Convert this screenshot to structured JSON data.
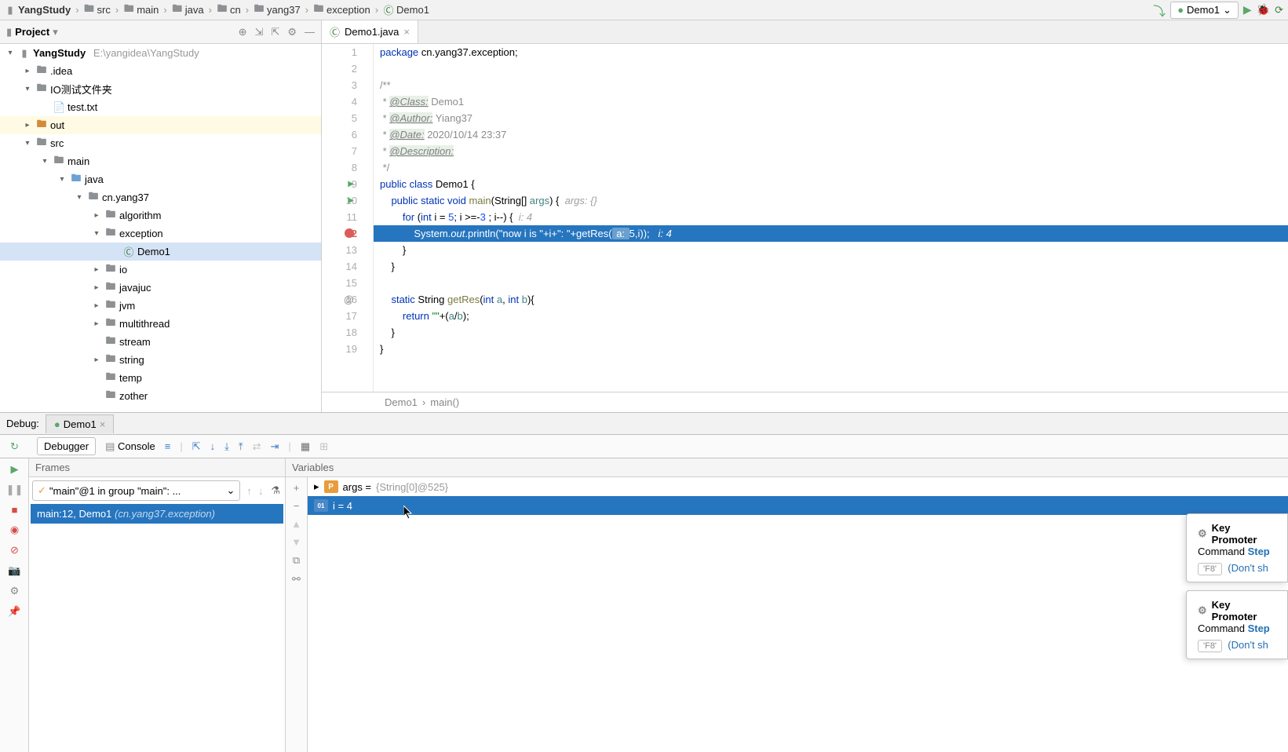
{
  "breadcrumbs": [
    "YangStudy",
    "src",
    "main",
    "java",
    "cn",
    "yang37",
    "exception",
    "Demo1"
  ],
  "run_config": "Demo1",
  "project": {
    "title": "Project",
    "root": "YangStudy",
    "root_path": "E:\\yangidea\\YangStudy",
    "nodes": {
      "idea": ".idea",
      "io_folder": "IO测试文件夹",
      "test_txt": "test.txt",
      "out": "out",
      "src": "src",
      "main": "main",
      "java": "java",
      "cn_yang37": "cn.yang37",
      "algorithm": "algorithm",
      "exception": "exception",
      "demo1": "Demo1",
      "io": "io",
      "javajuc": "javajuc",
      "jvm": "jvm",
      "multithread": "multithread",
      "stream": "stream",
      "string": "string",
      "temp": "temp",
      "zother": "zother"
    }
  },
  "tab": "Demo1.java",
  "code": {
    "l1": "package cn.yang37.exception;",
    "l3": "/**",
    "l4_tag": "@Class:",
    "l4_val": " Demo1",
    "l5_tag": "@Author:",
    "l5_val": " Yiang37",
    "l6_tag": "@Date:",
    "l6_val": " 2020/10/14 23:37",
    "l7_tag": "@Description:",
    "l8": " */",
    "l9": "public class Demo1 {",
    "l10_a": "    public static void main(String[] args) {  ",
    "l10_hint": "args: {}",
    "l11_a": "        for (int i = 5; i >=-3 ; i--) {  ",
    "l11_hint": "i: 4",
    "l12": "            System.out.println(\"now i is \"+i+\": \"+getRes( a: 5,i));   i: 4",
    "l13": "        }",
    "l14": "    }",
    "l16_a": "    static String getRes(int a, int b){",
    "l17": "        return \"\"+(a/b);",
    "l18": "    }",
    "l19": "}"
  },
  "crumb_bottom": {
    "a": "Demo1",
    "b": "main()"
  },
  "debug": {
    "label": "Debug:",
    "tab": "Demo1",
    "debugger": "Debugger",
    "console": "Console",
    "frames": "Frames",
    "variables": "Variables",
    "thread": "\"main\"@1 in group \"main\": ...",
    "frame_a": "main:12, Demo1 ",
    "frame_b": "(cn.yang37.exception)",
    "var_args": "args = ",
    "var_args_val": "{String[0]@525}",
    "var_i": "i = 4"
  },
  "popup": {
    "title": "Key Promoter",
    "cmd": "Command ",
    "step": "Step",
    "f8": "'F8'",
    "dont": "(Don't sh"
  }
}
